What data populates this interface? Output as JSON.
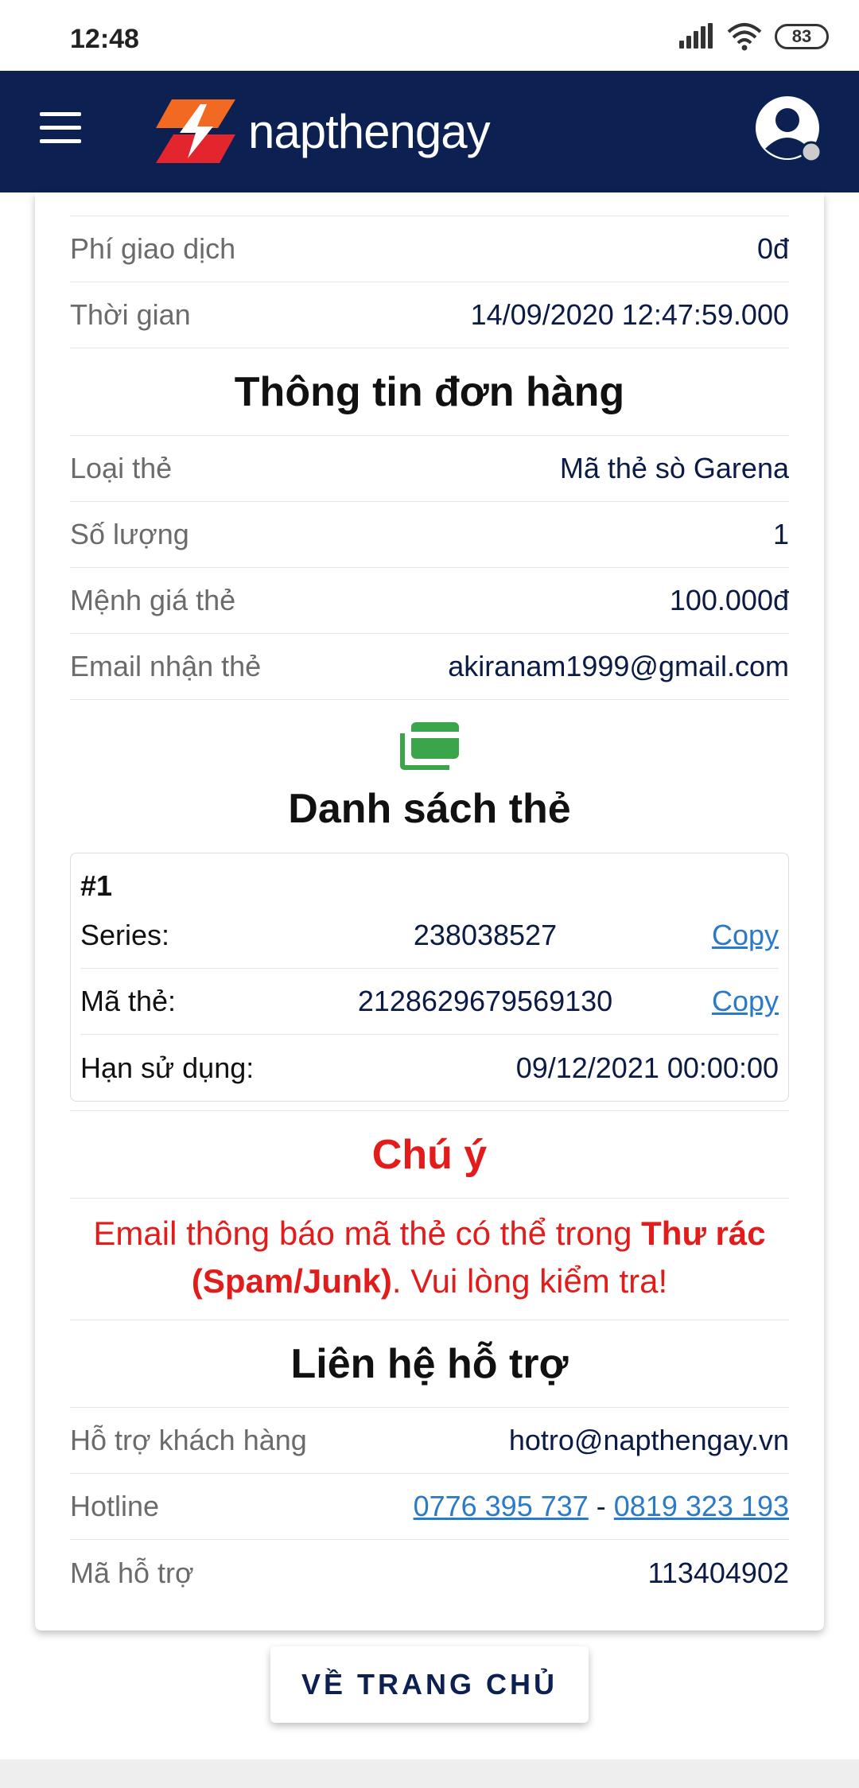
{
  "status_bar": {
    "time": "12:48",
    "battery": "83"
  },
  "header": {
    "brand": "napthengay",
    "icons": [
      "menu-icon",
      "lightning-logo-icon",
      "user-avatar-icon"
    ]
  },
  "transaction": {
    "fee_label": "Phí giao dịch",
    "fee_value": "0đ",
    "time_label": "Thời gian",
    "time_value": "14/09/2020 12:47:59.000"
  },
  "order": {
    "title": "Thông tin đơn hàng",
    "rows": [
      {
        "label": "Loại thẻ",
        "value": "Mã thẻ sò Garena"
      },
      {
        "label": "Số lượng",
        "value": "1"
      },
      {
        "label": "Mệnh giá thẻ",
        "value": "100.000đ"
      },
      {
        "label": "Email nhận thẻ",
        "value": "akiranam1999@gmail.com"
      }
    ]
  },
  "card_list": {
    "title": "Danh sách thẻ",
    "icon": "cards-icon",
    "icon_color": "#3aa54a",
    "item_number": "#1",
    "series_label": "Series:",
    "series_value": "238038527",
    "code_label": "Mã thẻ:",
    "code_value": "2128629679569130",
    "copy_label": "Copy",
    "expiry_label": "Hạn sử dụng:",
    "expiry_value": "09/12/2021 00:00:00"
  },
  "notice": {
    "title": "Chú ý",
    "text_before": "Email thông báo mã thẻ có thể trong ",
    "text_bold": "Thư rác (Spam/Junk)",
    "text_after": ". Vui lòng kiểm tra!",
    "color": "#e21b1b"
  },
  "support": {
    "title": "Liên hệ hỗ trợ",
    "customer_label": "Hỗ trợ khách hàng",
    "customer_value": "hotro@napthengay.vn",
    "hotline_label": "Hotline",
    "hotline_1": "0776 395 737",
    "hotline_sep": " - ",
    "hotline_2": "0819 323 193",
    "code_label": "Mã hỗ trợ",
    "code_value": "113404902"
  },
  "home_button": "VỀ TRANG CHỦ",
  "colors": {
    "header_bg": "#0c2152",
    "link": "#2a7ac9",
    "logo_orange": "#f26a21",
    "logo_red": "#e3262d"
  }
}
